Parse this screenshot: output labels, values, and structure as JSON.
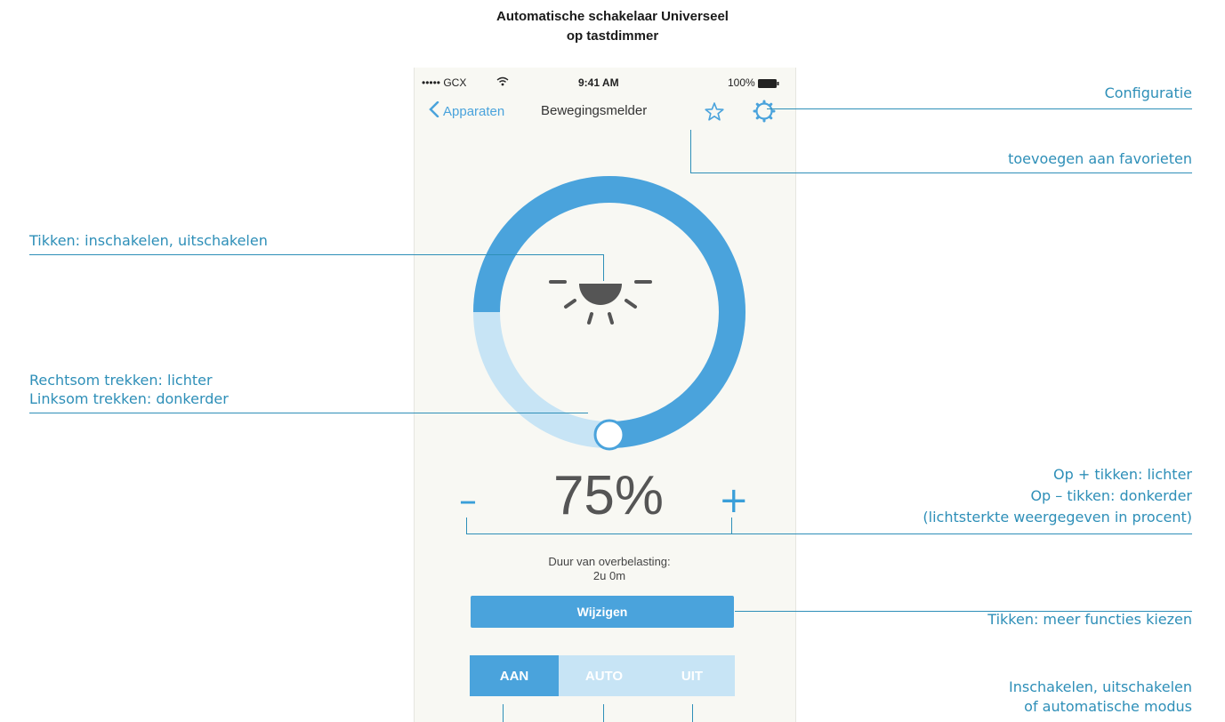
{
  "title": {
    "line1": "Automatische schakelaar Universeel",
    "line2": "op tastdimmer"
  },
  "status_bar": {
    "carrier": "••••• GCX",
    "time": "9:41 AM",
    "battery": "100%"
  },
  "nav": {
    "back_label": "Apparaten",
    "title": "Bewegingsmelder"
  },
  "dimmer": {
    "brightness_level": 0.75,
    "percent_label": "75%",
    "minus": "–",
    "plus": "+"
  },
  "overload": {
    "label": "Duur van overbelasting:",
    "value": "2u 0m"
  },
  "buttons": {
    "wijzigen": "Wijzigen"
  },
  "modes": [
    {
      "label": "AAN",
      "active": true
    },
    {
      "label": "AUTO",
      "active": false
    },
    {
      "label": "UIT",
      "active": false
    }
  ],
  "annotations": {
    "configuratie": "Configuratie",
    "favorieten": "toevoegen aan favorieten",
    "tikken_schakelen": "Tikken: inschakelen, uitschakelen",
    "rechtsom": "Rechtsom trekken: lichter",
    "linksom": "Linksom trekken: donkerder",
    "plus_tikken": "Op + tikken: lichter",
    "minus_tikken": "Op – tikken: donkerder",
    "procent": "(lichtsterkte weergegeven in procent)",
    "meer_functies": "Tikken: meer functies kiezen",
    "modus_1": "Inschakelen, uitschakelen",
    "modus_2": "of automatische modus"
  },
  "colors": {
    "accent": "#4aa3dc",
    "accent_light": "#c7e4f5",
    "annotation": "#2e8fb8",
    "phone_bg": "#f8f8f3"
  }
}
